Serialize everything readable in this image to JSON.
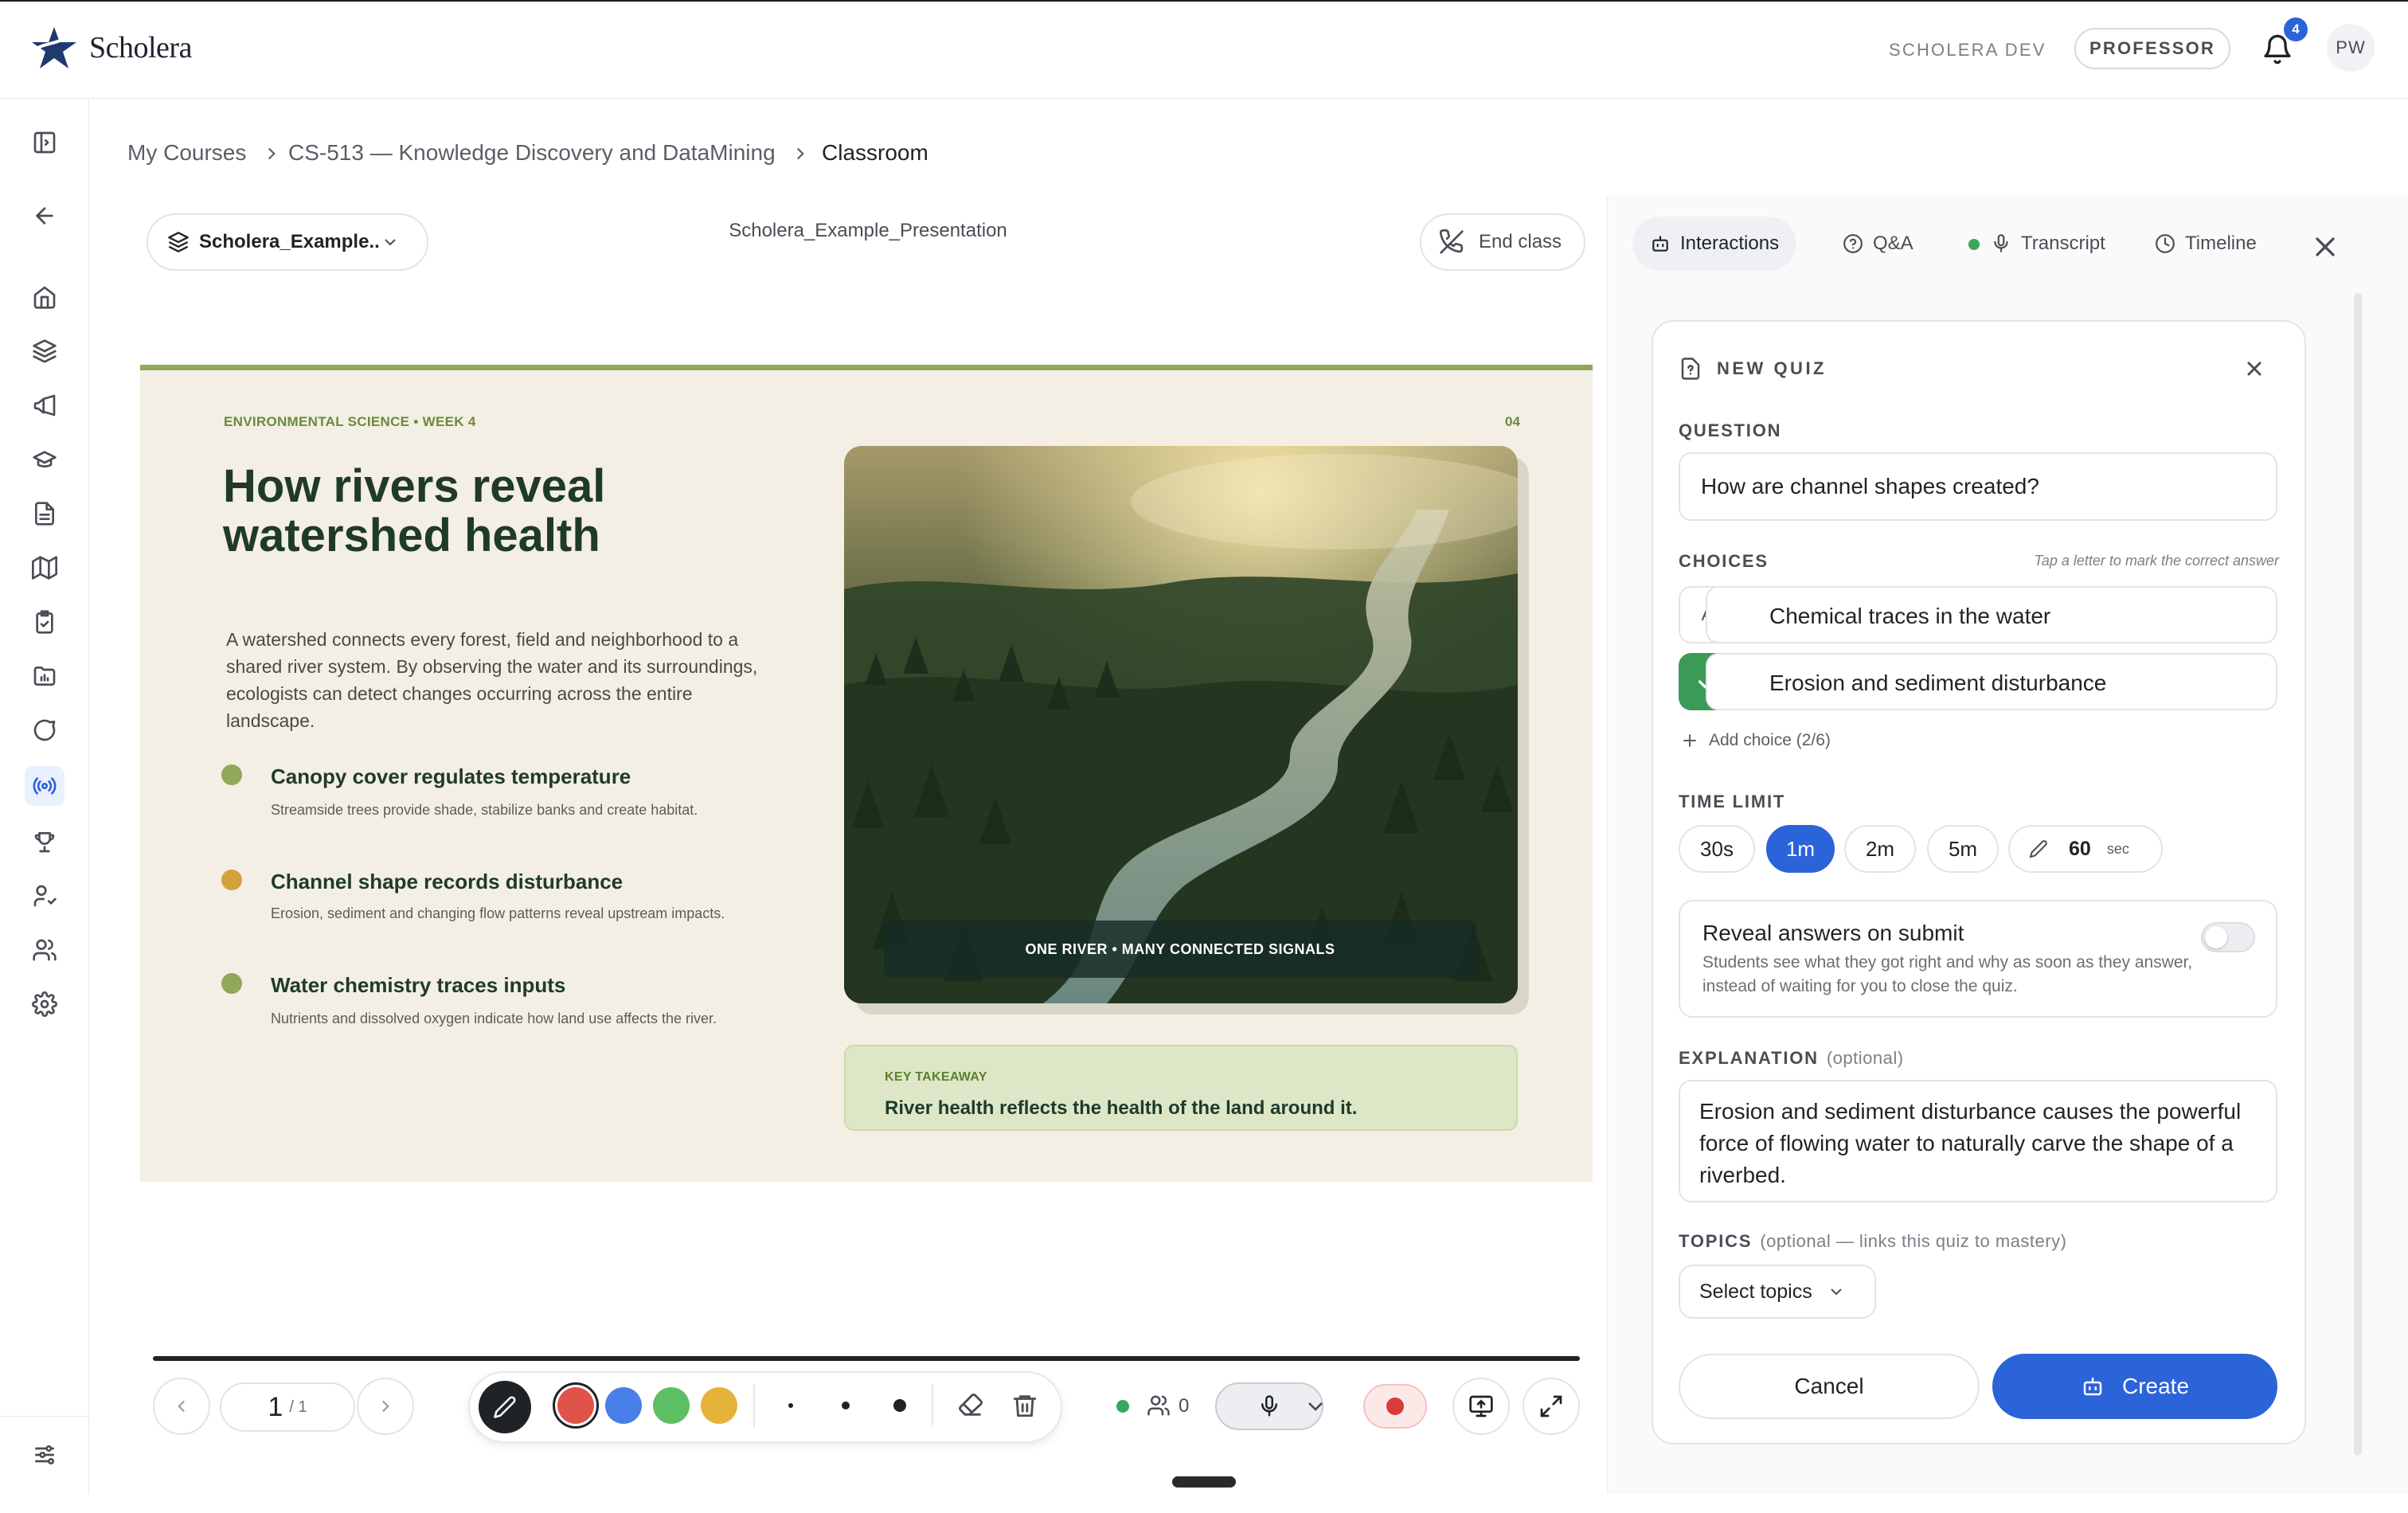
{
  "app": {
    "brand": "Scholera",
    "env_label": "SCHOLERA DEV",
    "role": "PROFESSOR",
    "notifications": "4",
    "user_initials": "PW"
  },
  "breadcrumb": {
    "items": [
      "My Courses",
      "CS-513 — Knowledge Discovery and DataMining",
      "Classroom"
    ]
  },
  "deck": {
    "selector_label": "Scholera_Example...",
    "presentation_title": "Scholera_Example_Presentation",
    "end_class": "End class"
  },
  "slide": {
    "kicker": "ENVIRONMENTAL SCIENCE  •  WEEK 4",
    "number": "04",
    "title": "How rivers reveal watershed health",
    "body": "A watershed connects every forest, field and neighborhood to a shared river system. By observing the water and its surroundings, ecologists can detect changes occurring across the entire landscape.",
    "bullets": [
      {
        "heading": "Canopy cover regulates temperature",
        "text": "Streamside trees provide shade, stabilize banks and create habitat.",
        "color": "#8fa85a"
      },
      {
        "heading": "Channel shape records disturbance",
        "text": "Erosion, sediment and changing flow patterns reveal upstream impacts.",
        "color": "#d4a23c"
      },
      {
        "heading": "Water chemistry traces inputs",
        "text": "Nutrients and dissolved oxygen indicate how land use affects the river.",
        "color": "#8fa85a"
      }
    ],
    "image_caption": "ONE RIVER  •  MANY CONNECTED SIGNALS",
    "takeaway_kicker": "KEY TAKEAWAY",
    "takeaway_text": "River health reflects the health of the land around it."
  },
  "controls": {
    "page_current": "1",
    "page_total": "/ 1",
    "colors": [
      "#e0534a",
      "#4a7ee8",
      "#5cbf64",
      "#e5b23a"
    ],
    "participants": "0"
  },
  "panel": {
    "tabs": [
      "Interactions",
      "Q&A",
      "Transcript",
      "Timeline"
    ],
    "quiz": {
      "header": "NEW QUIZ",
      "question_label": "QUESTION",
      "question": "How are channel shapes created?",
      "choices_label": "CHOICES",
      "choices_hint": "Tap a letter to mark the correct answer",
      "choices": [
        {
          "letter": "A",
          "text": "Chemical traces in the water",
          "correct": false
        },
        {
          "letter": "B",
          "text": "Erosion and sediment disturbance",
          "correct": true
        }
      ],
      "add_choice": "Add choice (2/6)",
      "time_limit_label": "TIME LIMIT",
      "time_options": [
        "30s",
        "1m",
        "2m",
        "5m"
      ],
      "time_selected": "1m",
      "custom_value": "60",
      "custom_unit": "sec",
      "reveal_title": "Reveal answers on submit",
      "reveal_desc": "Students see what they got right and why as soon as they answer, instead of waiting for you to close the quiz.",
      "reveal_on": false,
      "explanation_label": "EXPLANATION",
      "explanation_optional": "(optional)",
      "explanation": "Erosion and sediment disturbance causes the powerful force of flowing water to naturally carve the shape of a riverbed.",
      "topics_label": "TOPICS",
      "topics_optional": "(optional — links this quiz to mastery)",
      "topics_placeholder": "Select topics",
      "cancel": "Cancel",
      "create": "Create"
    }
  }
}
